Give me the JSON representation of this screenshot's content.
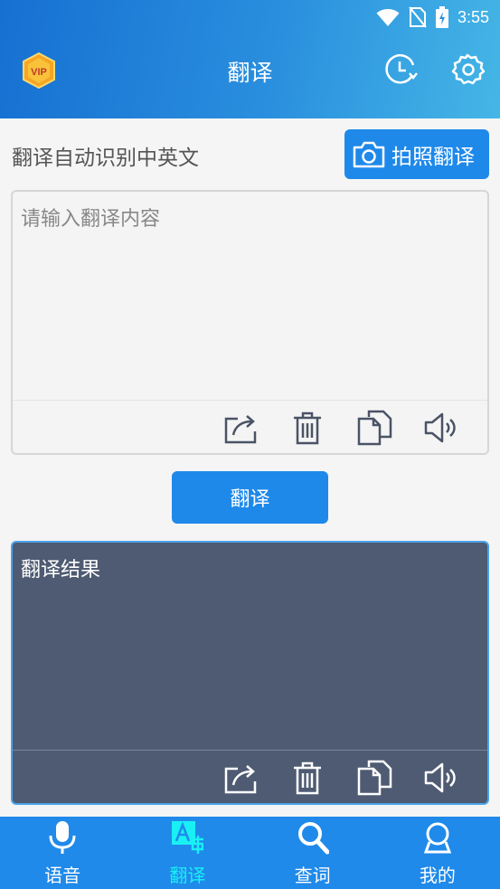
{
  "status": {
    "time": "3:55"
  },
  "header": {
    "title": "翻译",
    "vip_badge": "VIP"
  },
  "info": {
    "auto_detect_text": "翻译自动识别中英文",
    "photo_button_label": "拍照翻译"
  },
  "input": {
    "placeholder": "请输入翻译内容",
    "value": ""
  },
  "translate_button_label": "翻译",
  "result": {
    "label": "翻译结果"
  },
  "icons": {
    "header": [
      "vip-icon",
      "history-icon",
      "settings-icon"
    ],
    "toolbar": [
      "share-icon",
      "trash-icon",
      "copy-icon",
      "speaker-icon"
    ]
  },
  "nav": {
    "items": [
      {
        "label": "语音",
        "icon": "microphone-icon",
        "active": false
      },
      {
        "label": "翻译",
        "icon": "translate-icon",
        "active": true
      },
      {
        "label": "查词",
        "icon": "search-icon",
        "active": false
      },
      {
        "label": "我的",
        "icon": "profile-icon",
        "active": false
      }
    ]
  },
  "colors": {
    "primary": "#1f89ea",
    "header_start": "#1670d2",
    "header_end": "#45b6e6",
    "result_bg": "#4f5b72",
    "active_nav": "#19f0f4"
  }
}
